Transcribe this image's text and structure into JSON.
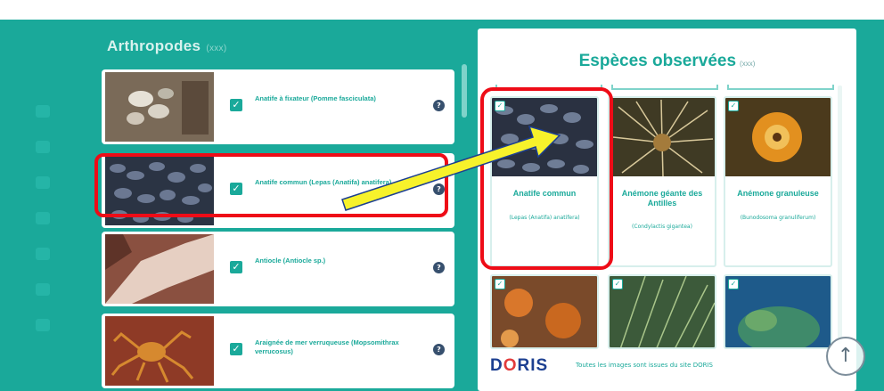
{
  "category": {
    "title": "Arthropodes",
    "count": "(xxx)"
  },
  "left_cards": [
    {
      "name": "Anatife à fixateur (Pomme fasciculata)",
      "help": "?",
      "img": "barnacle"
    },
    {
      "name": "Anatife commun (Lepas (Anatifa) anatifera)",
      "help": "?",
      "img": "mussel"
    },
    {
      "name": "Antiocle (Antiocle sp.)",
      "help": "?",
      "img": "flesh"
    },
    {
      "name": "Araignée de mer verruqueuse (Mopsomithrax verrucosus)",
      "help": "?",
      "img": "crab"
    }
  ],
  "observed": {
    "title": "Espèces observées",
    "count": "(xxx)"
  },
  "tiles": [
    {
      "name": "Anatife commun",
      "sci": "(Lepas (Anatifa) anatifera)",
      "img": "mussel"
    },
    {
      "name": "Anémone géante des Antilles",
      "sci": "(Condylactis gigantea)",
      "img": "anemone"
    },
    {
      "name": "Anémone granuleuse",
      "sci": "(Bunodosoma granuliferum)",
      "img": "coral"
    },
    {
      "name": "",
      "sci": "",
      "img": "reef"
    },
    {
      "name": "",
      "sci": "",
      "img": "grass"
    },
    {
      "name": "",
      "sci": "",
      "img": "blue"
    }
  ],
  "footer": {
    "logo_pre": "D",
    "logo_o": "O",
    "logo_post": "RIS",
    "text": "Toutes les images sont issues du site DORIS"
  },
  "scroll_up_icon": "↑",
  "check_mark": "✓",
  "colors": {
    "teal": "#1aa99a",
    "highlight": "#ee0c17",
    "arrow": "#f7f22b"
  }
}
